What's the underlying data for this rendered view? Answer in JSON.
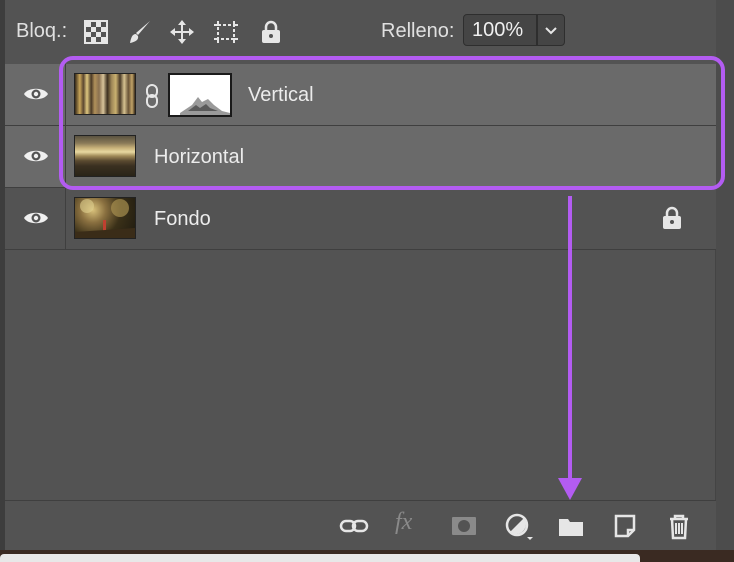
{
  "toolbar": {
    "lock_label": "Bloq.:",
    "lock_icons": [
      "lock-transparent-pixels-icon",
      "lock-image-pixels-icon",
      "lock-position-icon",
      "lock-artboard-icon",
      "lock-all-icon"
    ],
    "fill_label": "Relleno:",
    "fill_value": "100%"
  },
  "layers": [
    {
      "name": "Vertical",
      "visible": true,
      "selected": true,
      "has_mask": true,
      "locked": false
    },
    {
      "name": "Horizontal",
      "visible": true,
      "selected": true,
      "has_mask": false,
      "locked": false
    },
    {
      "name": "Fondo",
      "visible": true,
      "selected": false,
      "has_mask": false,
      "locked": true
    }
  ],
  "bottom_tools": [
    "link-layers-icon",
    "fx-icon",
    "add-mask-icon",
    "adjustment-layer-icon",
    "new-group-folder-icon",
    "new-layer-icon",
    "delete-layer-icon"
  ],
  "fx_label": "fx",
  "colors": {
    "panel_bg": "#535353",
    "selected_row": "#6a6a6a",
    "annotation": "#b35cf2"
  }
}
